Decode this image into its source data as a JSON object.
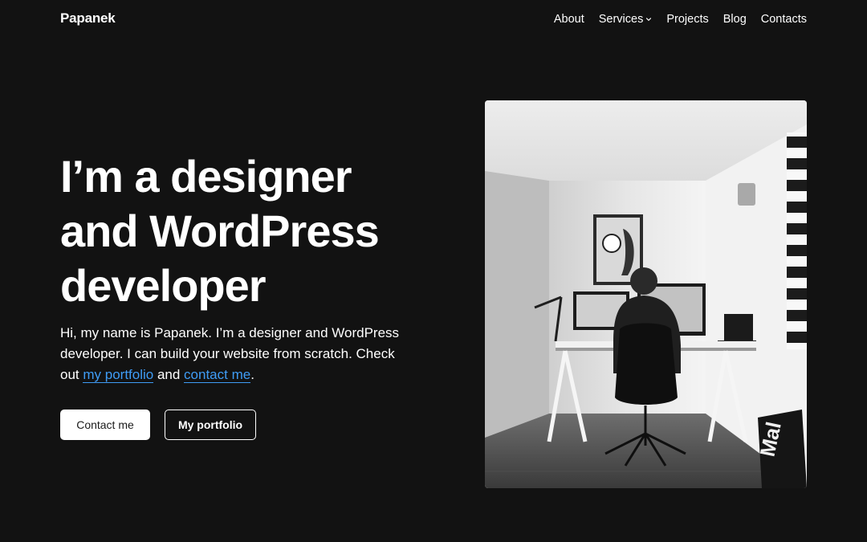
{
  "header": {
    "brand": "Papanek",
    "nav": [
      {
        "label": "About"
      },
      {
        "label": "Services",
        "has_dropdown": true
      },
      {
        "label": "Projects"
      },
      {
        "label": "Blog"
      },
      {
        "label": "Contacts"
      }
    ]
  },
  "hero": {
    "title_lines": [
      "I’m a designer",
      "and WordPress",
      "developer"
    ],
    "intro": {
      "before": "Hi, my name is Papanek. I’m a designer and WordPress developer. I can build your website from scratch. Check out ",
      "link1": "my portfolio",
      "between": " and ",
      "link2": "contact me",
      "after": "."
    },
    "buttons": {
      "primary": "Contact me",
      "secondary": "My portfolio"
    }
  },
  "image": {
    "alt": "Man working at desk with computers",
    "bag_text": "Mal"
  },
  "colors": {
    "background": "#121212",
    "text": "#ffffff",
    "link": "#3f9cf5"
  }
}
